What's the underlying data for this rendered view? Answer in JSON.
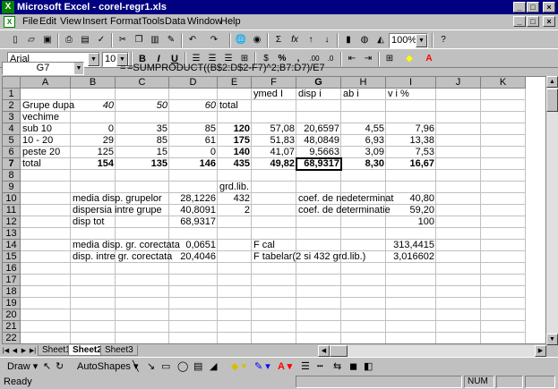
{
  "window": {
    "title": "Microsoft Excel - corel-regr1.xls",
    "app_icon": "X",
    "min": "_",
    "max": "□",
    "close": "×"
  },
  "menu": [
    "File",
    "Edit",
    "View",
    "Insert",
    "Format",
    "Tools",
    "Data",
    "Window",
    "Help"
  ],
  "toolbar": {
    "zoom": "100%",
    "sigma": "Σ",
    "fx": "fx",
    "bold": "B",
    "italic": "I",
    "underline": "U",
    "currency": "$",
    "percent": "%",
    "comma": ",",
    "decimals_inc": ".00",
    "help": "?"
  },
  "format": {
    "font": "Arial",
    "size": "10"
  },
  "formula_bar": {
    "name_box": "G7",
    "eq": "=",
    "formula": "=SUMPRODUCT((B$2:D$2-F7)^2;B7:D7)/E7"
  },
  "columns": [
    "A",
    "B",
    "C",
    "D",
    "E",
    "F",
    "G",
    "H",
    "I",
    "J",
    "K"
  ],
  "rows": [
    "1",
    "2",
    "3",
    "4",
    "5",
    "6",
    "7",
    "8",
    "9",
    "10",
    "11",
    "12",
    "13",
    "14",
    "15",
    "16",
    "17",
    "18",
    "19",
    "20",
    "21",
    "22",
    "23"
  ],
  "cells": {
    "F1": "ymed I",
    "G1": "disp i",
    "H1": "ab i",
    "I1": "v  i %",
    "A2": "Grupe dupa",
    "B2": "40",
    "C2": "50",
    "D2": "60",
    "E2": "total",
    "A3": "vechime",
    "A4": "sub 10",
    "B4": "0",
    "C4": "35",
    "D4": "85",
    "E4": "120",
    "F4": "57,08",
    "G4": "20,6597",
    "H4": "4,55",
    "I4": "7,96",
    "A5": " 10 - 20",
    "B5": "29",
    "C5": "85",
    "D5": "61",
    "E5": "175",
    "F5": "51,83",
    "G5": "48,0849",
    "H5": "6,93",
    "I5": "13,38",
    "A6": "peste 20",
    "B6": "125",
    "C6": "15",
    "D6": "0",
    "E6": "140",
    "F6": "41,07",
    "G6": "9,5663",
    "H6": "3,09",
    "I6": "7,53",
    "A7": "total",
    "B7": "154",
    "C7": "135",
    "D7": "146",
    "E7": "435",
    "F7": "49,82",
    "G7": "68,9317",
    "H7": "8,30",
    "I7": "16,67",
    "E9": "grd.lib.",
    "B10": "media disp. grupelor",
    "D10": "28,1226",
    "E10": "432",
    "G10": "coef. de nedeterminat",
    "I10": "40,80",
    "B11": "dispersia intre grupe",
    "D11": "40,8091",
    "E11": "2",
    "G11": "coef. de determinatie",
    "I11": "59,20",
    "B12": "disp tot",
    "D12": "68,9317",
    "I12": "100",
    "B14": "media disp. gr. corectata",
    "D14": "0,0651",
    "F14": "F cal",
    "I14": "313,4415",
    "B15": "disp. intre gr. corectata",
    "D15": "20,4046",
    "F15": "F tabelar(2 si 432 grd.lib.)",
    "I15": "3,016602"
  },
  "sheets": [
    "Sheet1",
    "Sheet2",
    "Sheet3"
  ],
  "active_sheet": "Sheet2",
  "drawbar": {
    "draw": "Draw",
    "autoshapes": "AutoShapes"
  },
  "status": {
    "text": "Ready",
    "num": "NUM"
  }
}
